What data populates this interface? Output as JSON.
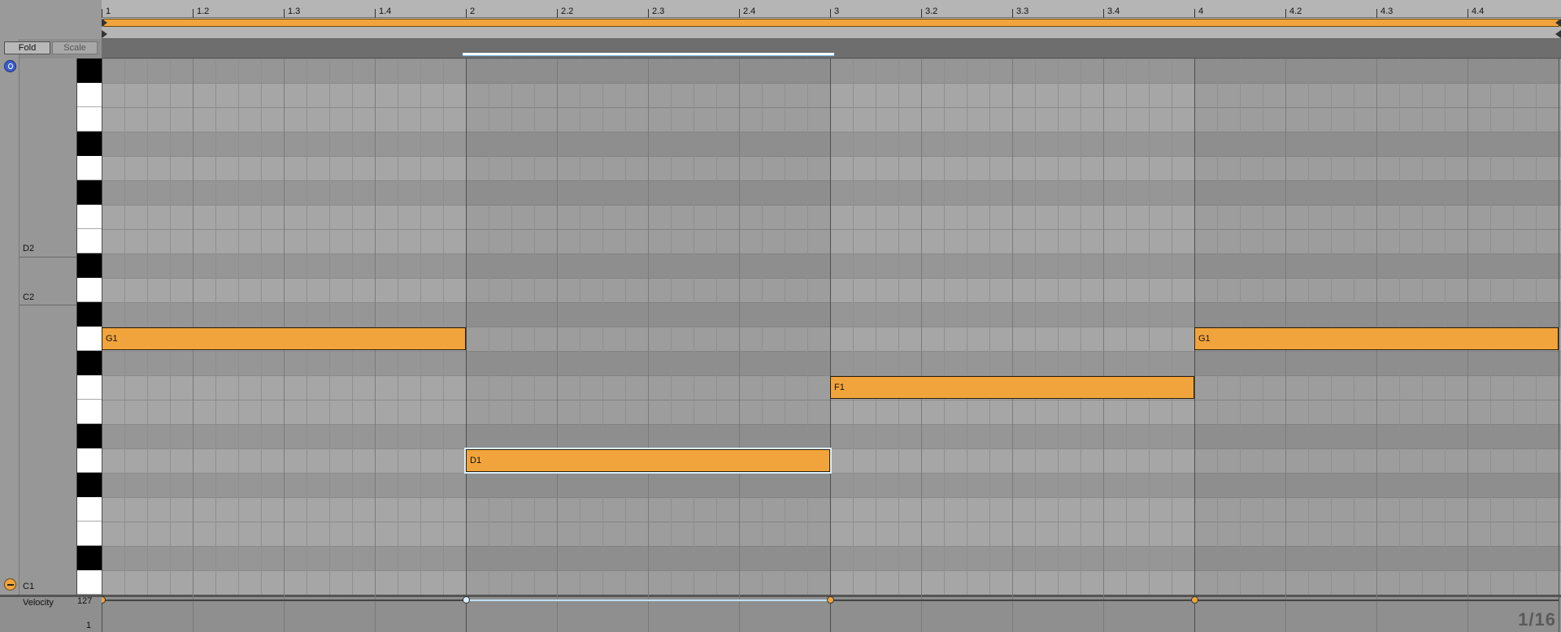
{
  "header": {
    "fold_label": "Fold",
    "scale_label": "Scale"
  },
  "ruler": {
    "ticks": [
      "1",
      "1.2",
      "1.3",
      "1.4",
      "2",
      "2.2",
      "2.3",
      "2.4",
      "3",
      "3.2",
      "3.3",
      "3.4",
      "4",
      "4.2",
      "4.3",
      "4.4"
    ]
  },
  "keyboard": {
    "labels": [
      {
        "name": "D2"
      },
      {
        "name": "C2"
      },
      {
        "name": "C1"
      }
    ]
  },
  "notes": [
    {
      "pitch": "G1",
      "start_bar": 1.0,
      "length_beats": 4,
      "selected": false
    },
    {
      "pitch": "D1",
      "start_bar": 2.0,
      "length_beats": 4,
      "selected": true
    },
    {
      "pitch": "F1",
      "start_bar": 3.0,
      "length_beats": 4,
      "selected": false
    },
    {
      "pitch": "G1",
      "start_bar": 4.0,
      "length_beats": 4,
      "selected": false
    }
  ],
  "velocity": {
    "label": "Velocity",
    "max": "127",
    "min": "1",
    "values": [
      127,
      127,
      127,
      127
    ]
  },
  "grid": {
    "setting": "1/16"
  },
  "colors": {
    "note_fill": "#f2a43c",
    "selection": "#dbeefc",
    "fold_toggle": "#3a5fd0"
  },
  "icons": {
    "fold_toggle": "fold-toggle-icon",
    "preview": "preview-icon",
    "velocity_toggle": "velocity-toggle-icon",
    "play": "play-icon"
  }
}
